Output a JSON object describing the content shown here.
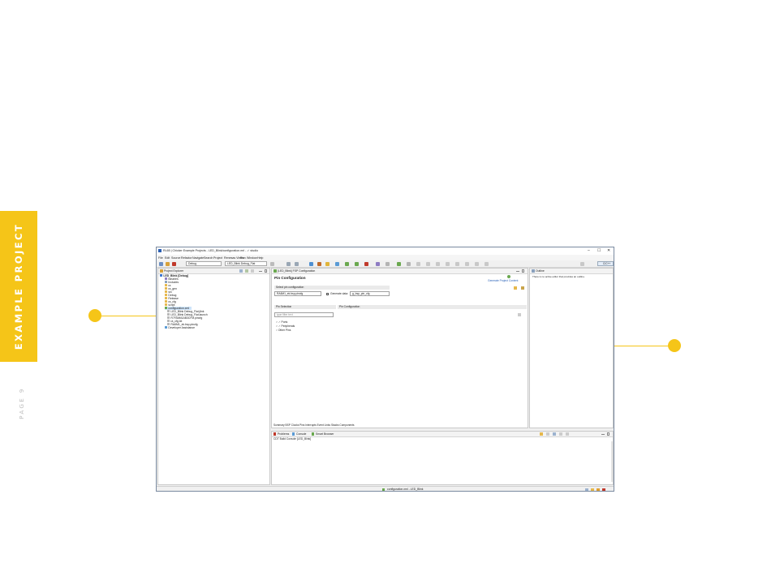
{
  "slide": {
    "banner": "EXAMPLE PROJECT",
    "page_label": "PAGE 9",
    "accent_color": "#f5c518"
  },
  "window": {
    "title": "RL65 | Chicker Example Projects - LED_Blink/configuration.mrl - ✓ studio",
    "controls": [
      "–",
      "☐",
      "✕"
    ]
  },
  "menu": [
    "File",
    "Edit",
    "Source",
    "Refactor",
    "Navigate",
    "Search",
    "Project",
    "Renesas Views",
    "Run",
    "Window",
    "Help"
  ],
  "toolbar": {
    "build_config": "Debug",
    "launch_config": "LED_Blink Debug_Flat",
    "perspective": "C/C++"
  },
  "project_explorer": {
    "title": "Project Explorer",
    "items": [
      {
        "label": "LED_Blink [Debug]",
        "icon": "project-icon"
      },
      {
        "label": "Binaries",
        "icon": "binaries-icon"
      },
      {
        "label": "Includes",
        "icon": "includes-icon"
      },
      {
        "label": "ra",
        "icon": "folder-icon"
      },
      {
        "label": "ra_gen",
        "icon": "folder-icon"
      },
      {
        "label": "src",
        "icon": "folder-icon"
      },
      {
        "label": "Debug",
        "icon": "folder-icon"
      },
      {
        "label": "Release",
        "icon": "folder-icon"
      },
      {
        "label": "ra_cfg",
        "icon": "folder-icon"
      },
      {
        "label": "script",
        "icon": "folder-icon"
      },
      {
        "label": "configuration.xml",
        "icon": "config-file-icon"
      },
      {
        "label": "LED_Blink Debug_Flat.jlink",
        "icon": "file-icon"
      },
      {
        "label": "LED_Blink Debug_Flat.launch",
        "icon": "file-icon"
      },
      {
        "label": "R7FA6M1AB3CFM.pincfg",
        "icon": "file-icon"
      },
      {
        "label": "ra_cfg.txt",
        "icon": "file-icon"
      },
      {
        "label": "RA6M1_ek.bsp.pincfg",
        "icon": "file-icon"
      },
      {
        "label": "Developer Assistance",
        "icon": "assistance-icon"
      }
    ]
  },
  "editor": {
    "tab": "[LED_Blink] FSP Configuration",
    "title": "Pin Configuration",
    "generate_link": "Generate Project Content",
    "select_pin_label": "Select pin configuration",
    "pin_config_value": "RA6M1_ek.bsp.pincfg",
    "generate_data_label": "Generate data:",
    "generate_data_value": "g_bsp_pin_cfg",
    "pin_selection_label": "Pin Selection",
    "pin_configuration_label": "Pin Configuration",
    "filter_placeholder": "type filter text",
    "tree": [
      "Ports",
      "Peripherals",
      "Other Pins"
    ],
    "bottom_tabs": "Summary  BSP  Clocks  Pins  Interrupts  Event Links  Stacks  Components"
  },
  "outline": {
    "title": "Outline",
    "message": "There is no active editor that provides an outline."
  },
  "console": {
    "tabs": [
      "Problems",
      "Console",
      "Smart Browser"
    ],
    "header": "CDT Build Console [LED_Blink]"
  },
  "status": {
    "file": "configuration.xml - LED_Blink"
  }
}
